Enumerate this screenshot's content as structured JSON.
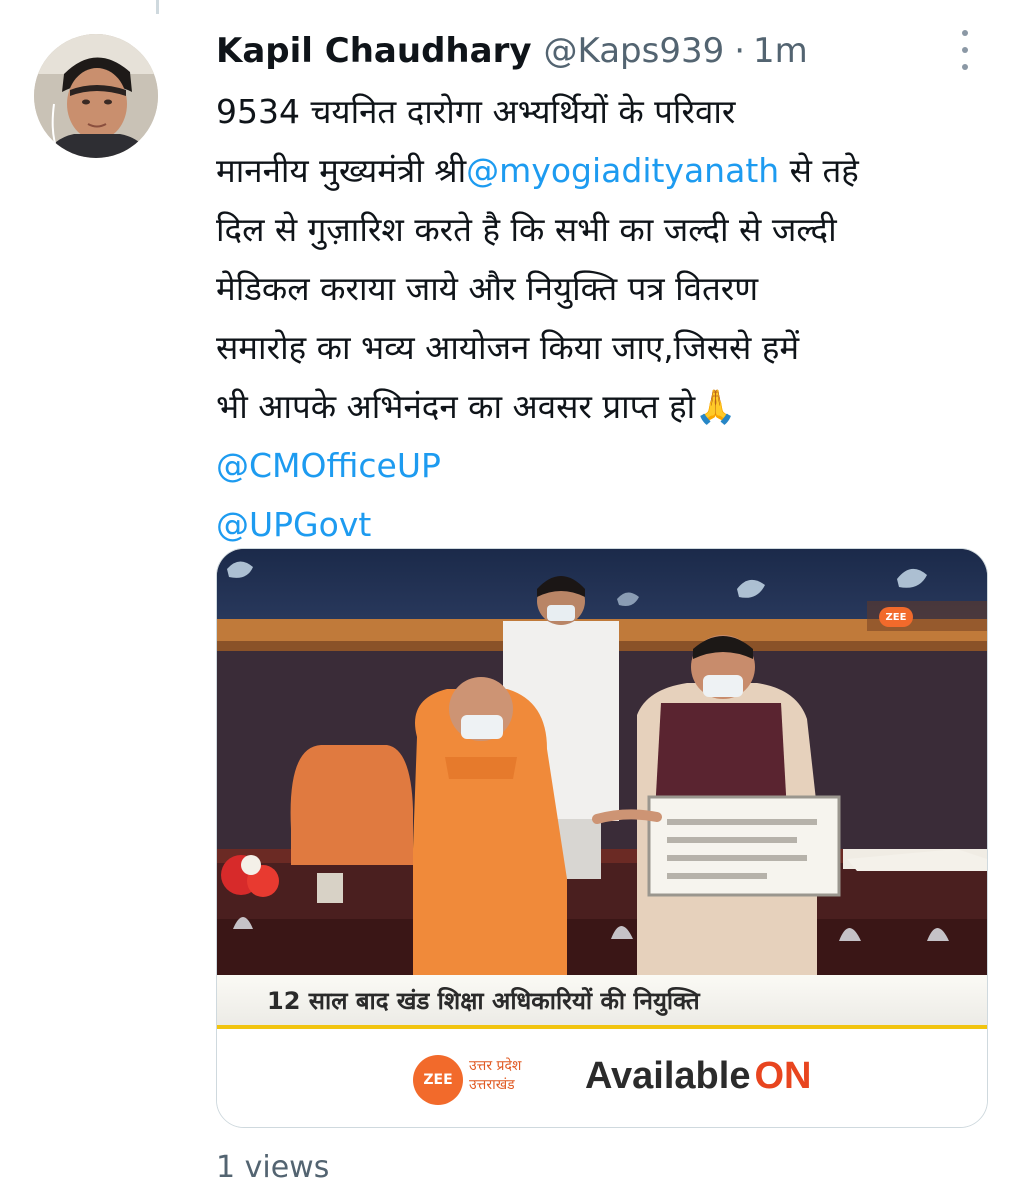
{
  "tweet": {
    "author_name": "Kapil Chaudhary",
    "author_handle": "@Kaps939",
    "separator": "·",
    "timestamp": "1m",
    "text_lines": [
      [
        {
          "text": "9534 चयनित दारोगा अभ्यर्थियों के परिवार"
        }
      ],
      [
        {
          "text": "माननीय मुख्यमंत्री श्री"
        },
        {
          "text": "@myogiadityanath",
          "mention": true
        },
        {
          "text": " से तहे"
        }
      ],
      [
        {
          "text": "दिल से गुज़ारिश करते है कि सभी का जल्दी से जल्दी"
        }
      ],
      [
        {
          "text": "मेडिकल कराया जाये और  नियुक्ति पत्र वितरण"
        }
      ],
      [
        {
          "text": "समारोह का भव्य आयोजन किया जाए,जिससे हमें"
        }
      ],
      [
        {
          "text": "भी आपके अभिनंदन का अवसर प्राप्त हो🙏"
        }
      ],
      [
        {
          "text": "@CMOfficeUP",
          "mention": true
        }
      ],
      [
        {
          "text": "@UPGovt",
          "mention": true
        }
      ]
    ]
  },
  "media": {
    "ticker_text": "12 साल बाद खंड शिक्षा अधिकारियों की नियुक्ति",
    "channel_badge": "ZEE",
    "channel_region_line1": "उत्तर प्रदेश",
    "channel_region_line2": "उत्तराखंड",
    "available_text": "Available",
    "available_on_text": "ON",
    "corner_badge": "ZEE"
  },
  "views_text": "1 views",
  "colors": {
    "mention": "#1d9bf0",
    "secondary_text": "#536471",
    "zee_orange": "#f26a2b"
  }
}
